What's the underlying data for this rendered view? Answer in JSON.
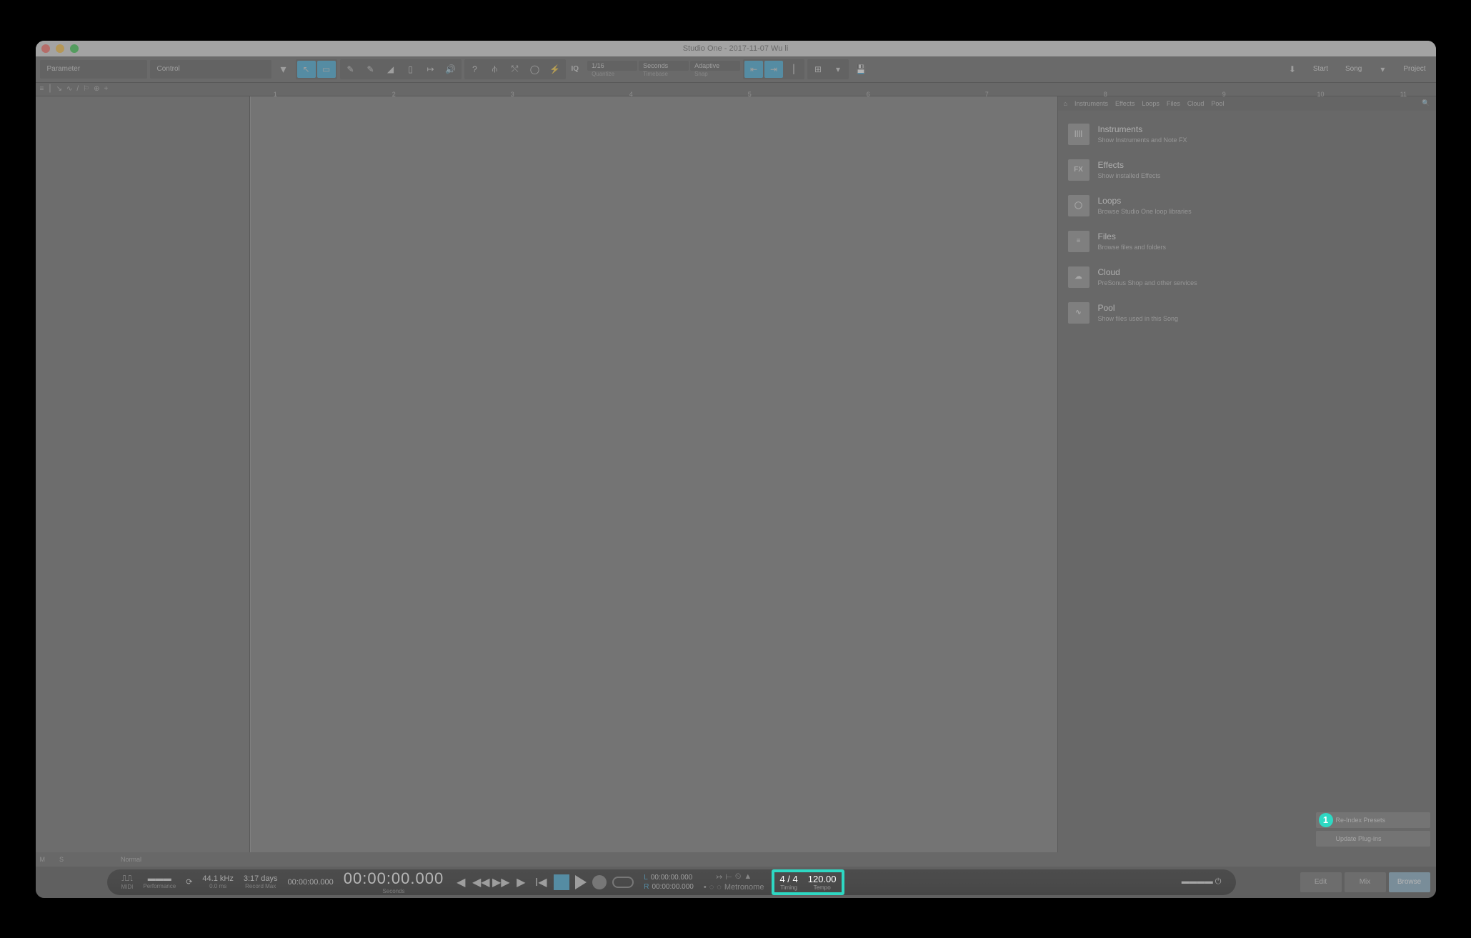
{
  "window": {
    "title": "Studio One - 2017-11-07 Wu li"
  },
  "toolbar": {
    "parameter_label": "Parameter",
    "control_label": "Control",
    "quantize_value": "1/16",
    "timebase_value": "Seconds",
    "snap_value": "Adaptive",
    "quantize_label": "Quantize",
    "timebase_label": "Timebase",
    "snap_label": "Snap",
    "iq_label": "IQ",
    "right_links": {
      "start": "Start",
      "song": "Song",
      "project": "Project"
    }
  },
  "ruler": {
    "ticks": [
      "1",
      "2",
      "3",
      "4",
      "5",
      "6",
      "7",
      "8",
      "9",
      "10",
      "11"
    ]
  },
  "browser": {
    "tabs": [
      "Instruments",
      "Effects",
      "Loops",
      "Files",
      "Cloud",
      "Pool"
    ],
    "items": [
      {
        "icon": "||||",
        "title": "Instruments",
        "sub": "Show Instruments and Note FX"
      },
      {
        "icon": "FX",
        "title": "Effects",
        "sub": "Show installed Effects"
      },
      {
        "icon": "◯",
        "title": "Loops",
        "sub": "Browse Studio One loop libraries"
      },
      {
        "icon": "≡",
        "title": "Files",
        "sub": "Browse files and folders"
      },
      {
        "icon": "☁",
        "title": "Cloud",
        "sub": "PreSonus Shop and other services"
      },
      {
        "icon": "∿",
        "title": "Pool",
        "sub": "Show files used in this Song"
      }
    ],
    "footer": {
      "reindex": "Re-Index Presets",
      "update": "Update Plug-ins"
    }
  },
  "bottom_strip": {
    "m": "M",
    "s": "S",
    "normal": "Normal"
  },
  "transport": {
    "midi": "MIDI",
    "performance": "Performance",
    "sample_rate": "44.1 kHz",
    "latency": "0.0 ms",
    "record_time": "3:17 days",
    "record_max": "Record Max",
    "position_small": "00:00:00.000",
    "position_large": "00:00:00.000",
    "position_unit": "Seconds",
    "loop_l": "00:00:00.000",
    "loop_r": "00:00:00.000",
    "metronome_label": "Metronome",
    "timing_value": "4 / 4",
    "timing_label": "Timing",
    "tempo_value": "120.00",
    "tempo_label": "Tempo",
    "right_buttons": {
      "edit": "Edit",
      "mix": "Mix",
      "browse": "Browse"
    }
  },
  "annotation": {
    "badge": "1"
  }
}
